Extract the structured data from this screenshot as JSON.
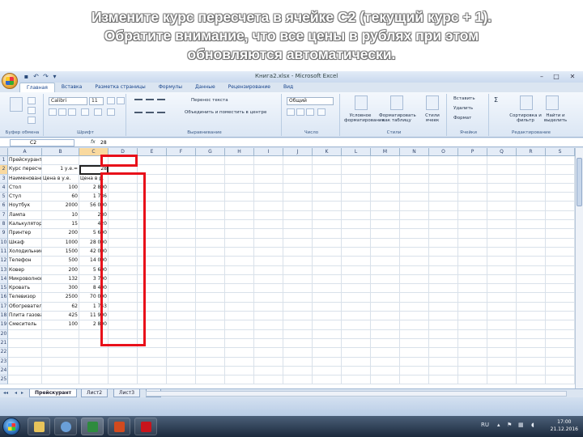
{
  "caption": {
    "line1": "Измените курс пересчета в ячейке С2 (текущий курс + 1).",
    "line2": "Обратите внимание, что все цены в рублях при этом",
    "line3": "обновляются автоматически."
  },
  "window": {
    "title": "Книга2.xlsx - Microsoft Excel",
    "minimize": "–",
    "maximize": "□",
    "close": "✕"
  },
  "ribbon": {
    "tabs": [
      "Главная",
      "Вставка",
      "Разметка страницы",
      "Формулы",
      "Данные",
      "Рецензирование",
      "Вид"
    ],
    "font_name": "Calibri",
    "font_size": "11",
    "number_format": "Общий",
    "wrap_text": "Перенос текста",
    "merge": "Объединить и поместить в центре",
    "conditional_format": "Условное форматирование",
    "format_table": "Форматировать как таблицу",
    "cell_styles": "Стили ячеек",
    "insert": "Вставить",
    "delete": "Удалить",
    "format": "Формат",
    "sort_filter": "Сортировка и фильтр",
    "find_select": "Найти и выделить",
    "groups": {
      "clipboard": "Буфер обмена",
      "font": "Шрифт",
      "alignment": "Выравнивание",
      "number": "Число",
      "styles": "Стили",
      "cells": "Ячейки",
      "editing": "Редактирование"
    }
  },
  "formula_bar": {
    "name_box": "C2",
    "fx": "fx",
    "formula": "28"
  },
  "columns": [
    "A",
    "B",
    "C",
    "D",
    "E",
    "F",
    "G",
    "H",
    "I",
    "J",
    "K",
    "L",
    "M",
    "N",
    "O",
    "P",
    "Q",
    "R",
    "S"
  ],
  "rows": [
    {
      "n": "1",
      "a": "Прейскурант",
      "b": "",
      "c": ""
    },
    {
      "n": "2",
      "a": "Курс пересчета",
      "b": "1 у.е.=",
      "c": "28"
    },
    {
      "n": "3",
      "a": "Наименование товара",
      "b": "Цена в у.е.",
      "c": "Цена в р."
    },
    {
      "n": "4",
      "a": "Стол",
      "b": "100",
      "c": "2 800"
    },
    {
      "n": "5",
      "a": "Стул",
      "b": "60",
      "c": "1 736"
    },
    {
      "n": "6",
      "a": "Ноутбук",
      "b": "2000",
      "c": "56 000"
    },
    {
      "n": "7",
      "a": "Лампа",
      "b": "10",
      "c": "280"
    },
    {
      "n": "8",
      "a": "Калькулятор",
      "b": "15",
      "c": "420"
    },
    {
      "n": "9",
      "a": "Принтер",
      "b": "200",
      "c": "5 600"
    },
    {
      "n": "10",
      "a": "Шкаф",
      "b": "1000",
      "c": "28 000"
    },
    {
      "n": "11",
      "a": "Холодильник",
      "b": "1500",
      "c": "42 000"
    },
    {
      "n": "12",
      "a": "Телефон",
      "b": "500",
      "c": "14 000"
    },
    {
      "n": "13",
      "a": "Ковер",
      "b": "200",
      "c": "5 600"
    },
    {
      "n": "14",
      "a": "Микроволновая печь",
      "b": "132",
      "c": "3 700"
    },
    {
      "n": "15",
      "a": "Кровать",
      "b": "300",
      "c": "8 400"
    },
    {
      "n": "16",
      "a": "Телевизор",
      "b": "2500",
      "c": "70 000"
    },
    {
      "n": "17",
      "a": "Обогреватель",
      "b": "62",
      "c": "1 743"
    },
    {
      "n": "18",
      "a": "Плита газовая",
      "b": "425",
      "c": "11 900"
    },
    {
      "n": "19",
      "a": "Смеситель",
      "b": "100",
      "c": "2 800"
    },
    {
      "n": "20",
      "a": "",
      "b": "",
      "c": ""
    },
    {
      "n": "21",
      "a": "",
      "b": "",
      "c": ""
    },
    {
      "n": "22",
      "a": "",
      "b": "",
      "c": ""
    },
    {
      "n": "23",
      "a": "",
      "b": "",
      "c": ""
    },
    {
      "n": "24",
      "a": "",
      "b": "",
      "c": ""
    },
    {
      "n": "25",
      "a": "",
      "b": "",
      "c": ""
    }
  ],
  "sheet_tabs": [
    "Прейскурант",
    "Лист2",
    "Лист3"
  ],
  "taskbar": {
    "lang": "RU",
    "time": "17:00",
    "date": "21.12.2016"
  },
  "colors": {
    "highlight": "#e8101a",
    "ribbon_bg": "#dbe5f1",
    "taskbar": "#1c2a3d"
  }
}
